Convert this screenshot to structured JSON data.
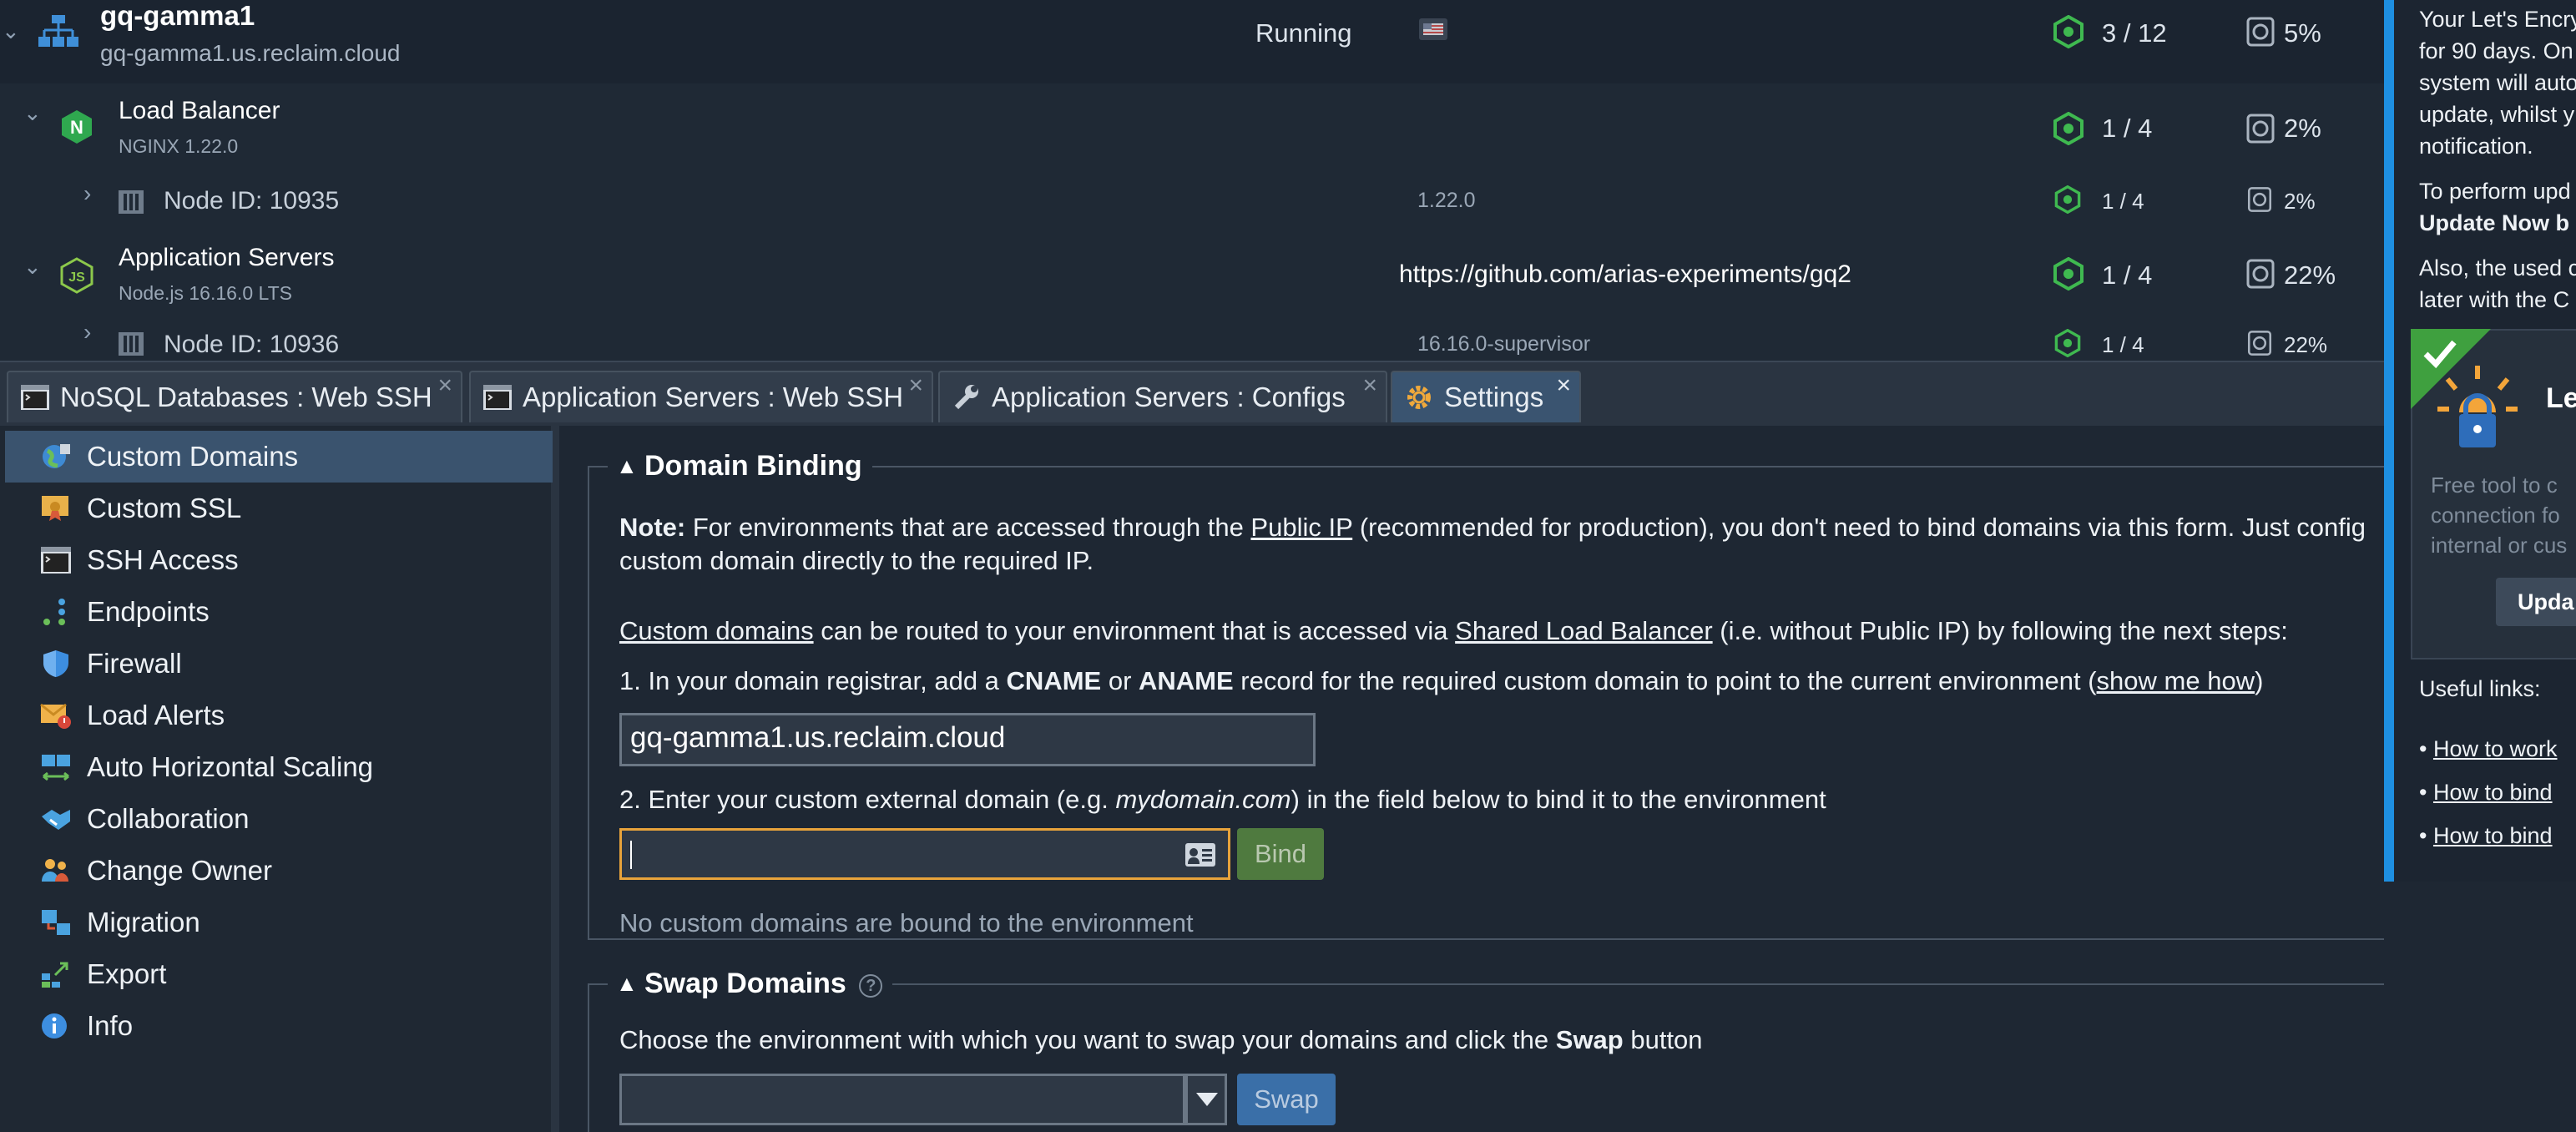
{
  "env": {
    "name": "gq-gamma1",
    "domain": "gq-gamma1.us.reclaim.cloud",
    "status": "Running",
    "nodes": "3 / 12",
    "disk": "5%"
  },
  "load_balancer": {
    "name": "Load Balancer",
    "version": "NGINX 1.22.0",
    "nodes": "1 / 4",
    "disk": "2%"
  },
  "node1": {
    "label": "Node ID: 10935",
    "tag": "1.22.0",
    "nodes": "1 / 4",
    "disk": "2%"
  },
  "app_servers": {
    "name": "Application Servers",
    "version": "Node.js 16.16.0 LTS",
    "repo": "https://github.com/arias-experiments/gq2",
    "nodes": "1 / 4",
    "disk": "22%"
  },
  "node2": {
    "label": "Node ID: 10936",
    "tag": "16.16.0-supervisor",
    "nodes": "1 / 4",
    "disk": "22%"
  },
  "info_panel": {
    "l1": "Your Let's Encry",
    "l2": "for 90 days. On",
    "l3": "system will auto",
    "l4": "update, whilst y",
    "l5": "notification.",
    "l6": "To perform upd",
    "l7": "Update Now b",
    "l8": "Also, the used c",
    "l9": "later with the C",
    "card_title": "Le",
    "card_t1": "Free tool to c",
    "card_t2": "connection fo",
    "card_t3": "internal or cus",
    "card_btn": "Upda",
    "useful": "Useful links:",
    "link1": "How to work",
    "link2": "How to bind",
    "link3": "How to bind"
  },
  "tabs": [
    {
      "label": "NoSQL Databases : Web SSH"
    },
    {
      "label": "Application Servers : Web SSH"
    },
    {
      "label": "Application Servers : Configs"
    },
    {
      "label": "Settings"
    }
  ],
  "sidebar": [
    {
      "label": "Custom Domains",
      "icon": "globe-icon"
    },
    {
      "label": "Custom SSL",
      "icon": "certificate-icon"
    },
    {
      "label": "SSH Access",
      "icon": "terminal-icon"
    },
    {
      "label": "Endpoints",
      "icon": "endpoints-icon"
    },
    {
      "label": "Firewall",
      "icon": "shield-icon"
    },
    {
      "label": "Load Alerts",
      "icon": "alert-mail-icon"
    },
    {
      "label": "Auto Horizontal Scaling",
      "icon": "scaling-icon"
    },
    {
      "label": "Collaboration",
      "icon": "handshake-icon"
    },
    {
      "label": "Change Owner",
      "icon": "users-icon"
    },
    {
      "label": "Migration",
      "icon": "migration-icon"
    },
    {
      "label": "Export",
      "icon": "export-icon"
    },
    {
      "label": "Info",
      "icon": "info-icon"
    }
  ],
  "domain_binding": {
    "title": "Domain Binding",
    "note_label": "Note:",
    "note_a": " For environments that are accessed through the ",
    "public_ip": "Public IP",
    "note_b": " (recommended for production), you don't need to bind domains via this form. Just config",
    "note_c": "custom domain directly to the required IP.",
    "custom_domains": "Custom domains",
    "routed_a": " can be routed to your environment that is accessed via ",
    "slb": "Shared Load Balancer",
    "routed_b": " (i.e. without Public IP) by following the next steps:",
    "step1_a": "1. In your domain registrar, add a ",
    "cname": "CNAME",
    "or": " or ",
    "aname": "ANAME",
    "step1_b": " record for the required custom domain to point to the current environment (",
    "show_me_how": "show me how",
    "step1_c": ")",
    "env_domain": "gq-gamma1.us.reclaim.cloud",
    "step2_a": "2. Enter your custom external domain (e.g. ",
    "example": "mydomain.com",
    "step2_b": ") in the field below to bind it to the environment",
    "input_value": "",
    "bind_label": "Bind",
    "empty_text": "No custom domains are bound to the environment"
  },
  "swap_domains": {
    "title": "Swap Domains",
    "text_a": "Choose the environment with which you want to swap your domains and click the ",
    "swap_word": "Swap",
    "text_b": " button",
    "select_value": "",
    "swap_label": "Swap"
  },
  "colors": {
    "accent": "#1e8fe1",
    "green": "#3fb950",
    "bind_btn": "#4f7a3f",
    "swap_btn": "#3a6fa8",
    "input_focus": "#e8a33b"
  }
}
